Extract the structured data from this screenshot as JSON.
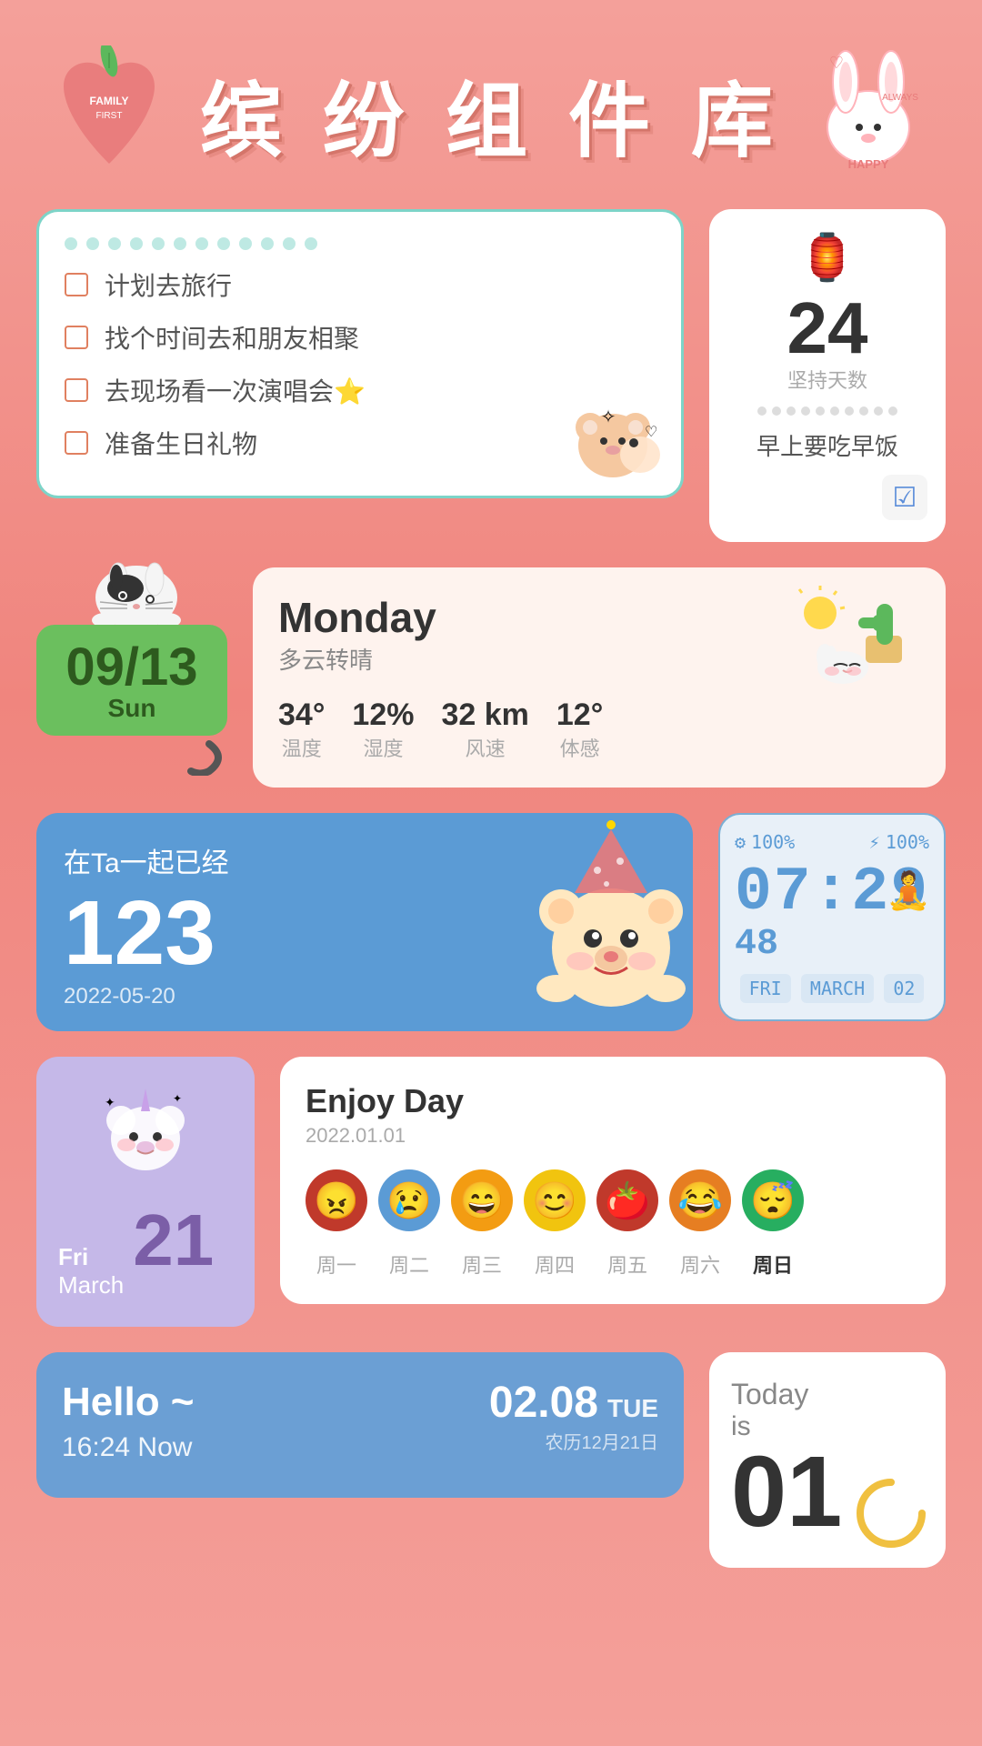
{
  "header": {
    "title": "缤 纷 组 件 库"
  },
  "todo": {
    "items": [
      "计划去旅行",
      "找个时间去和朋友相聚",
      "去现场看一次演唱会⭐",
      "准备生日礼物"
    ]
  },
  "streak": {
    "number": "24",
    "unit": "坚持天数",
    "text": "早上要吃早饭"
  },
  "calendar": {
    "date": "09/13",
    "day": "Sun"
  },
  "weather": {
    "day": "Monday",
    "description": "多云转晴",
    "temperature": "34°",
    "humidity": "12%",
    "wind": "32 km",
    "feel": "12°",
    "temp_label": "温度",
    "humidity_label": "湿度",
    "wind_label": "风速",
    "feel_label": "体感"
  },
  "couple": {
    "label": "在Ta一起已经",
    "days": "123",
    "start_date": "2022-05-20"
  },
  "clock": {
    "battery": "100%",
    "charging": "100%",
    "time": "07:29",
    "seconds": "48",
    "day": "FRI",
    "month": "MARCH",
    "date_num": "02"
  },
  "mini_cal": {
    "weekday": "Fri",
    "month": "March",
    "day": "21"
  },
  "mood": {
    "title": "Enjoy Day",
    "date": "2022.01.01",
    "days": [
      "周一",
      "周二",
      "周三",
      "周四",
      "周五",
      "周六",
      "周日"
    ],
    "active_day": "周日",
    "emojis": [
      "😠",
      "😢",
      "😄",
      "😊",
      "🍅",
      "😂",
      "😴"
    ]
  },
  "hello": {
    "greeting": "Hello ~",
    "time": "16:24 Now",
    "date": "02.08",
    "day_abbr": "TUE",
    "lunar": "农历12月21日"
  },
  "today": {
    "label": "Today",
    "is_label": "is",
    "number": "01"
  }
}
